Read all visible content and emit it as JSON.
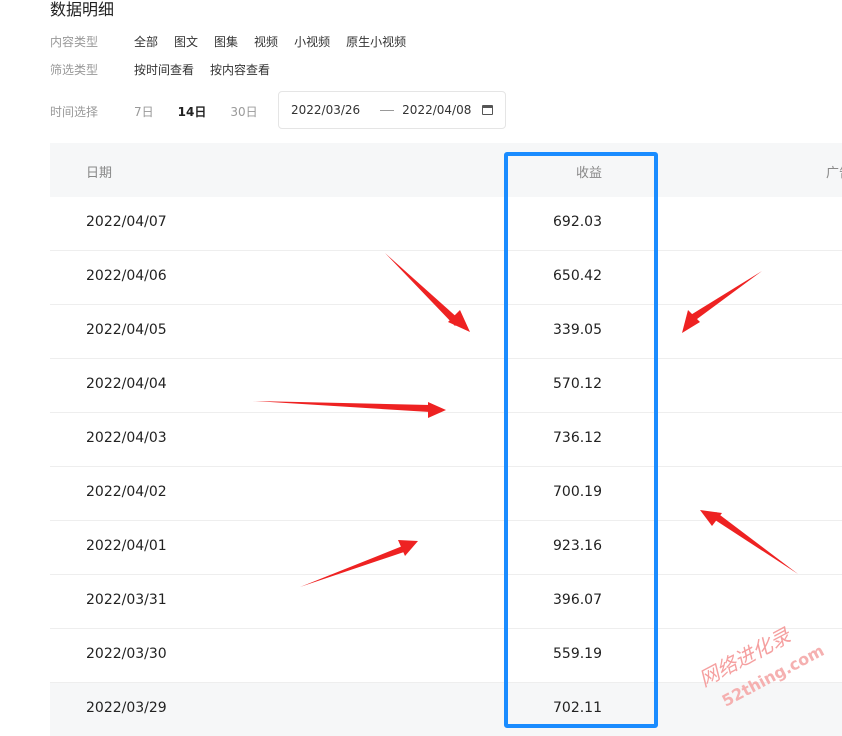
{
  "page_title": "数据明细",
  "filters": {
    "content_type_label": "内容类型",
    "content_types": [
      "全部",
      "图文",
      "图集",
      "视频",
      "小视频",
      "原生小视频"
    ],
    "filter_type_label": "筛选类型",
    "filter_types": [
      "按时间查看",
      "按内容查看"
    ]
  },
  "time": {
    "label": "时间选择",
    "options": [
      "7日",
      "14日",
      "30日"
    ],
    "active": "14日",
    "start_date": "2022/03/26",
    "end_date": "2022/04/08"
  },
  "table": {
    "headers": {
      "date": "日期",
      "income": "收益",
      "ad": "广告"
    },
    "rows": [
      {
        "date": "2022/04/07",
        "income": "692.03"
      },
      {
        "date": "2022/04/06",
        "income": "650.42"
      },
      {
        "date": "2022/04/05",
        "income": "339.05"
      },
      {
        "date": "2022/04/04",
        "income": "570.12"
      },
      {
        "date": "2022/04/03",
        "income": "736.12"
      },
      {
        "date": "2022/04/02",
        "income": "700.19"
      },
      {
        "date": "2022/04/01",
        "income": "923.16"
      },
      {
        "date": "2022/03/31",
        "income": "396.07"
      },
      {
        "date": "2022/03/30",
        "income": "559.19"
      },
      {
        "date": "2022/03/29",
        "income": "702.11"
      }
    ]
  },
  "colors": {
    "highlight": "#1a8cff",
    "arrow": "#ee2222",
    "watermark": "#f08080"
  },
  "watermark": {
    "text": "网络进化录",
    "site": "52thing.com"
  }
}
